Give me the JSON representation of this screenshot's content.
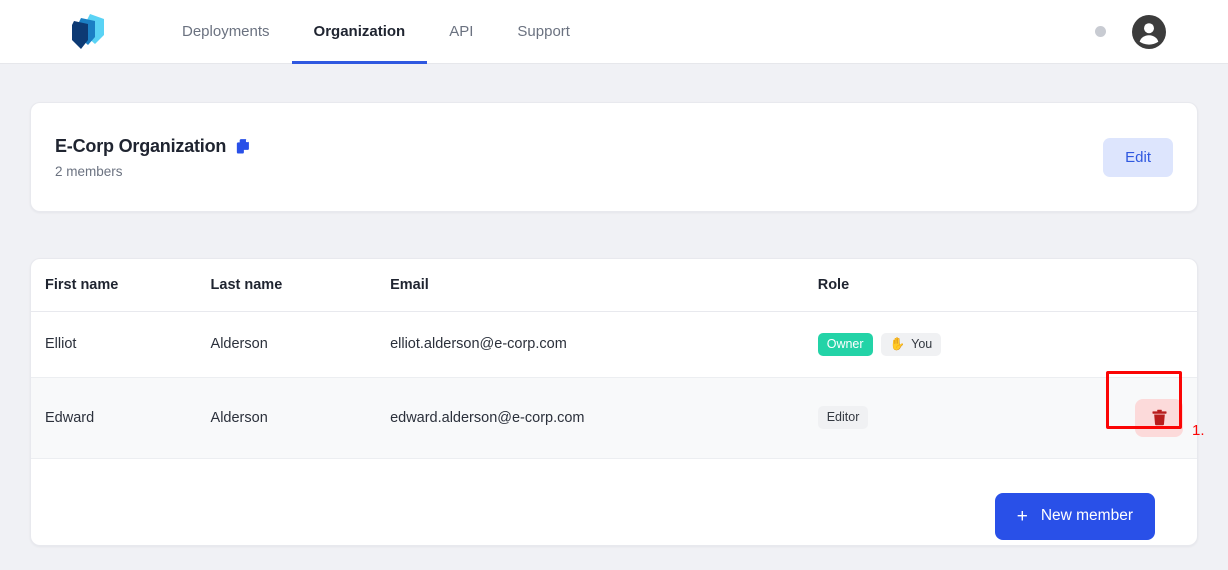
{
  "topnav": {
    "logo_name": "app-logo",
    "tabs": [
      {
        "label": "Deployments",
        "active": false
      },
      {
        "label": "Organization",
        "active": true
      },
      {
        "label": "API",
        "active": false
      },
      {
        "label": "Support",
        "active": false
      }
    ],
    "status_dot_color": "#c8cbd2",
    "avatar_label": "account-avatar"
  },
  "org_card": {
    "title": "E-Corp Organization",
    "copy_icon": "copy-icon",
    "members_count": "2 members",
    "edit_label": "Edit"
  },
  "members_table": {
    "headers": {
      "first_name": "First name",
      "last_name": "Last name",
      "email": "Email",
      "role": "Role"
    },
    "rows": [
      {
        "first_name": "Elliot",
        "last_name": "Alderson",
        "email": "elliot.alderson@e-corp.com",
        "role_badge": "Owner",
        "you_badge": "You",
        "you_badge_emoji": "✋",
        "has_delete": false,
        "hovered": false
      },
      {
        "first_name": "Edward",
        "last_name": "Alderson",
        "email": "edward.alderson@e-corp.com",
        "role_badge": "Editor",
        "you_badge": "",
        "you_badge_emoji": "",
        "has_delete": true,
        "hovered": true
      }
    ],
    "new_member_label": "New member",
    "plus_glyph": "+",
    "delete_icon": "trash-icon"
  },
  "annotation": {
    "step_number": "1.",
    "color": "#fb0505"
  },
  "colors": {
    "page_bg": "#f0f1f5",
    "accent_blue": "#2950e8",
    "tab_underline": "#2f58e0",
    "owner_badge": "#23d3a7",
    "edit_btn_bg": "#dde5fd",
    "delete_btn_bg": "#fcdada",
    "trash_icon": "#b81d1d"
  }
}
